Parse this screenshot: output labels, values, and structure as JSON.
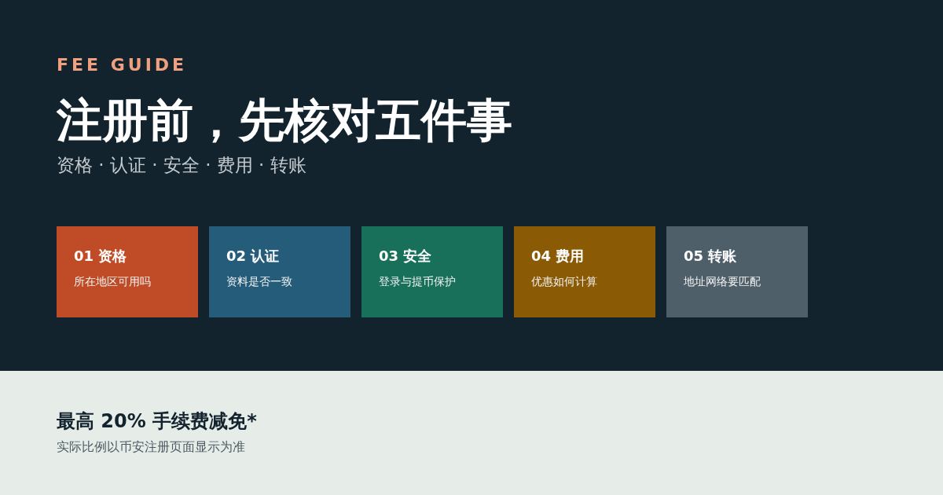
{
  "kicker": "FEE GUIDE",
  "title": "注册前，先核对五件事",
  "subtitle": "资格 · 认证 · 安全 · 费用 · 转账",
  "cards": [
    {
      "title": "01 资格",
      "text": "所在地区可用吗",
      "color": "#bf4c27"
    },
    {
      "title": "02 认证",
      "text": "资料是否一致",
      "color": "#245c7a"
    },
    {
      "title": "03 安全",
      "text": "登录与提币保护",
      "color": "#18705a"
    },
    {
      "title": "04 费用",
      "text": "优惠如何计算",
      "color": "#8a5a05"
    },
    {
      "title": "05 转账",
      "text": "地址网络要匹配",
      "color": "#4f5f69"
    }
  ],
  "footer": {
    "heading": "最高 20% 手续费减免*",
    "note": "实际比例以币安注册页面显示为准"
  }
}
